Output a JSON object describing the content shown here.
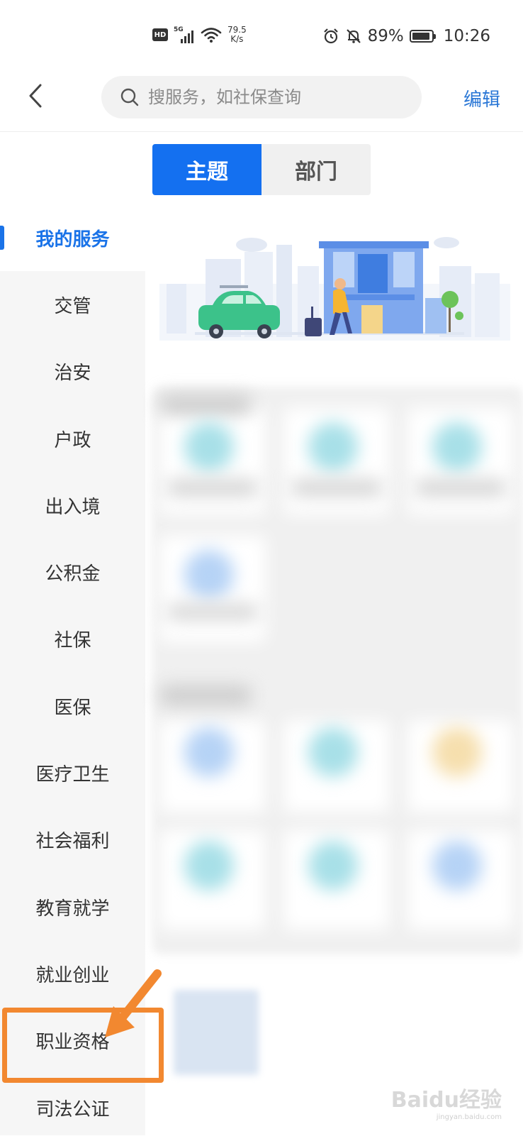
{
  "status_bar": {
    "network_speed": "79.5",
    "network_speed_unit": "K/s",
    "battery_percent": "89%",
    "time": "10:26"
  },
  "header": {
    "search_placeholder": "搜服务，如社保查询",
    "edit_label": "编辑"
  },
  "tabs": [
    {
      "label": "主题",
      "active": true
    },
    {
      "label": "部门",
      "active": false
    }
  ],
  "sidebar": {
    "items": [
      {
        "label": "我的服务",
        "active": true
      },
      {
        "label": "交管"
      },
      {
        "label": "治安"
      },
      {
        "label": "户政"
      },
      {
        "label": "出入境"
      },
      {
        "label": "公积金"
      },
      {
        "label": "社保"
      },
      {
        "label": "医保"
      },
      {
        "label": "医疗卫生"
      },
      {
        "label": "社会福利"
      },
      {
        "label": "教育就学"
      },
      {
        "label": "就业创业"
      },
      {
        "label": "职业资格"
      },
      {
        "label": "司法公证"
      }
    ]
  },
  "colors": {
    "accent": "#1470f0",
    "annotation": "#f28830"
  },
  "watermark": {
    "brand": "Baidu经验",
    "url": "jingyan.baidu.com"
  }
}
